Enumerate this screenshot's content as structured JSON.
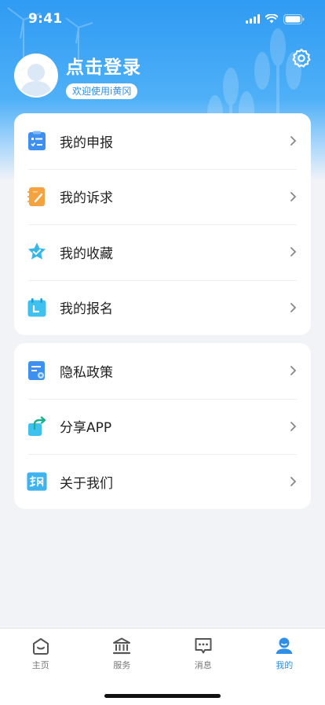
{
  "status_bar": {
    "time": "9:41"
  },
  "profile": {
    "title": "点击登录",
    "welcome": "欢迎使用i黄冈"
  },
  "menu_primary": [
    {
      "label": "我的申报",
      "icon": "declaration-icon"
    },
    {
      "label": "我的诉求",
      "icon": "appeal-icon"
    },
    {
      "label": "我的收藏",
      "icon": "favorite-star-icon"
    },
    {
      "label": "我的报名",
      "icon": "registration-calendar-icon"
    }
  ],
  "menu_secondary": [
    {
      "label": "隐私政策",
      "icon": "privacy-policy-icon"
    },
    {
      "label": "分享APP",
      "icon": "share-icon"
    },
    {
      "label": "关于我们",
      "icon": "about-logo-icon"
    }
  ],
  "tabbar": {
    "items": [
      {
        "label": "主页",
        "icon": "home-icon",
        "active": false
      },
      {
        "label": "服务",
        "icon": "service-bank-icon",
        "active": false
      },
      {
        "label": "消息",
        "icon": "message-icon",
        "active": false
      },
      {
        "label": "我的",
        "icon": "profile-icon",
        "active": true
      }
    ]
  },
  "colors": {
    "accent": "#2f8fe6",
    "header": "#2f9bf3",
    "background": "#f2f3f7"
  }
}
